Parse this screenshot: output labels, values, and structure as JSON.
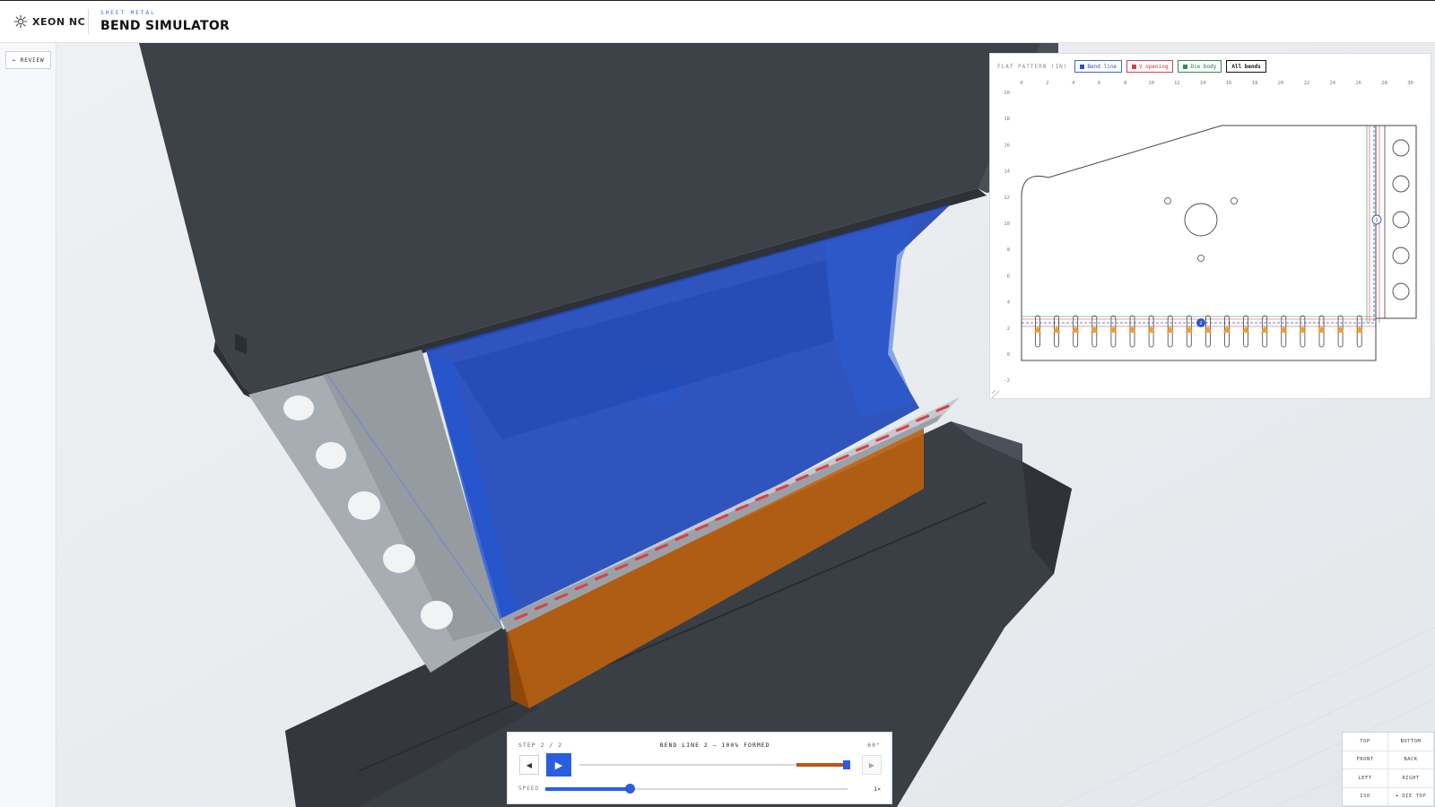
{
  "header": {
    "brand": "XEON NC",
    "subtitle": "SHEET METAL",
    "title": "BEND SIMULATOR"
  },
  "sidebar": {
    "back_label": "← REVIEW"
  },
  "flat_pattern": {
    "title": "FLAT PATTERN (IN)",
    "chips": {
      "bend_line": "Bend line",
      "v_opening": "V opening",
      "die_body": "Die body",
      "all_bends": "All bends"
    },
    "x_ticks": [
      "0",
      "2",
      "4",
      "6",
      "8",
      "10",
      "12",
      "14",
      "16",
      "18",
      "20",
      "22",
      "24",
      "26",
      "28",
      "30"
    ],
    "y_ticks": [
      "20",
      "18",
      "16",
      "14",
      "12",
      "10",
      "8",
      "6",
      "4",
      "2",
      "0",
      "-2"
    ],
    "bend_markers": [
      "1",
      "2"
    ],
    "colors": {
      "bend": "#2b55c6",
      "v_opening": "#d8404a",
      "die": "#2e8a56"
    }
  },
  "playback": {
    "step_label": "STEP 2 / 2",
    "status": "BEND LINE 2 — 100% FORMED",
    "angle": "60°",
    "progress": 1.0,
    "speed_label": "SPEED",
    "speed_value": "1×",
    "speed_fraction": 0.28,
    "prev_icon": "◀",
    "play_icon": "▶",
    "next_icon": "▶"
  },
  "views": [
    "TOP",
    "BOTTOM",
    "FRONT",
    "BACK",
    "LEFT",
    "RIGHT",
    "ISO",
    "⌖ DIE TOP"
  ],
  "colors": {
    "accent": "#2a5ee0",
    "machine": "#3d4148",
    "part_highlight": "#1f47b8",
    "die": "#b8600f",
    "sheet": "#a8adb3"
  }
}
